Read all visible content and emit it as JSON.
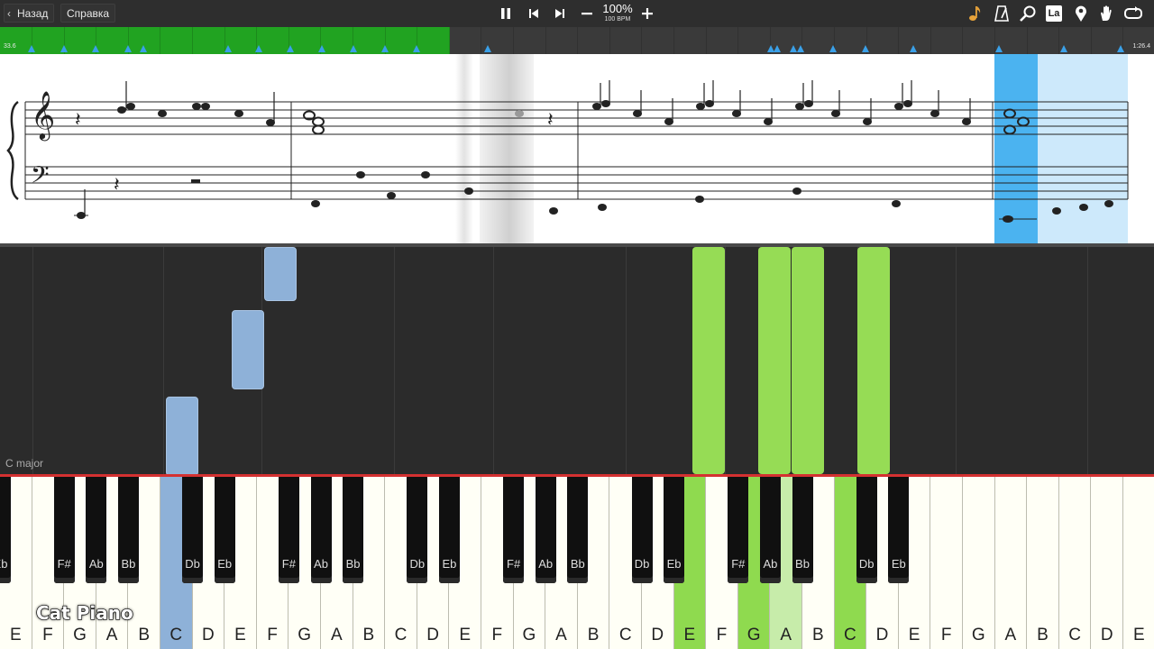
{
  "toolbar": {
    "back_label": "Назад",
    "help_label": "Справка",
    "tempo_percent": "100%",
    "tempo_bpm": "100 BPM",
    "controls": [
      "pause-icon",
      "skip-back-icon",
      "skip-forward-icon",
      "minus-icon",
      "plus-icon"
    ],
    "right_icons": [
      "note-icon",
      "metronome-icon",
      "magnifier-icon",
      "label-icon",
      "pin-icon",
      "hand-icon",
      "loop-icon"
    ],
    "label_icon_text": "La"
  },
  "timeline": {
    "start_label": "33.6",
    "end_label": "1:26.4",
    "played_fraction": 0.39,
    "played_color": "#21a321",
    "marker_color": "#3aa0e8"
  },
  "falling_notes": {
    "key_signature": "C major",
    "blue_color": "#8eb1d8",
    "green_color": "#96dc55"
  },
  "keyboard": {
    "white_keys": [
      "E",
      "F",
      "G",
      "A",
      "B",
      "C",
      "D",
      "E",
      "F",
      "G",
      "A",
      "B",
      "C",
      "D",
      "E",
      "F",
      "G",
      "A",
      "B",
      "C",
      "D",
      "E",
      "F",
      "G",
      "A",
      "B",
      "C",
      "D",
      "E",
      "F",
      "G",
      "A",
      "B",
      "C",
      "D",
      "E"
    ],
    "black_keys": [
      "Eb",
      "F#",
      "Ab",
      "Bb",
      "Db",
      "Eb",
      "F#",
      "Ab",
      "Bb",
      "Db",
      "Eb",
      "F#",
      "Ab",
      "Bb",
      "Db",
      "Eb",
      "F#",
      "Ab",
      "Bb",
      "Db",
      "Eb"
    ],
    "highlight_blue": "#8eb1d8",
    "highlight_green": "#8fda4f"
  },
  "branding": {
    "watermark": "Cat Piano"
  }
}
